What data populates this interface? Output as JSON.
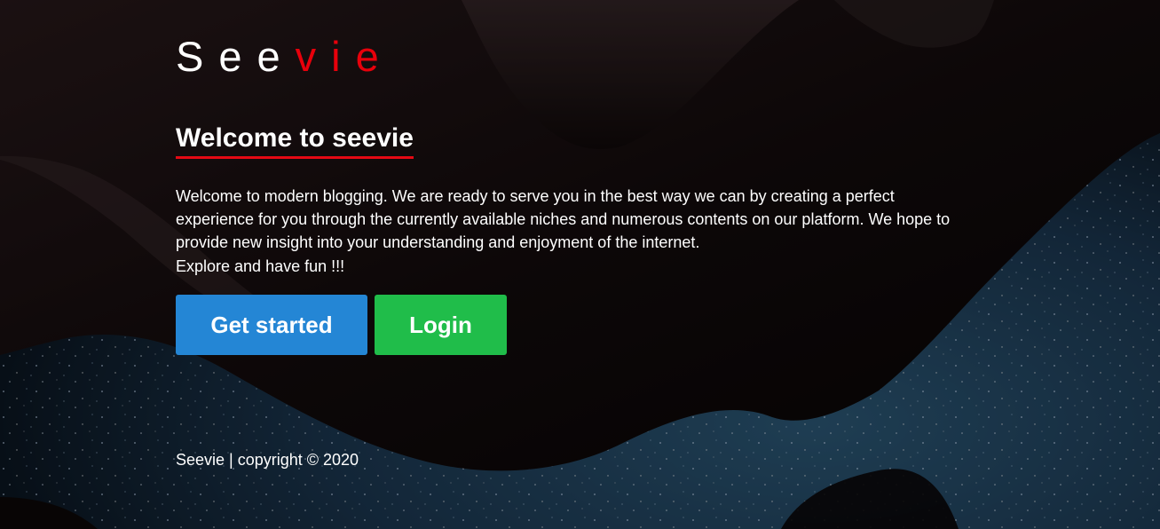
{
  "brand": {
    "logo_part1": "See",
    "logo_part2": "vie",
    "accent_color": "#e8000b"
  },
  "hero": {
    "heading": "Welcome to seevie",
    "intro": "Welcome to modern blogging. We are ready to serve you in the best way we can by creating a perfect experience for you through the currently available niches and numerous contents on our platform. We hope to provide new insight into your understanding and enjoyment of the internet.",
    "explore": "Explore and have fun !!!"
  },
  "actions": {
    "get_started_label": "Get started",
    "get_started_color": "#2486d5",
    "login_label": "Login",
    "login_color": "#20bd4a"
  },
  "footer": {
    "text": "Seevie | copyright © 2020"
  }
}
